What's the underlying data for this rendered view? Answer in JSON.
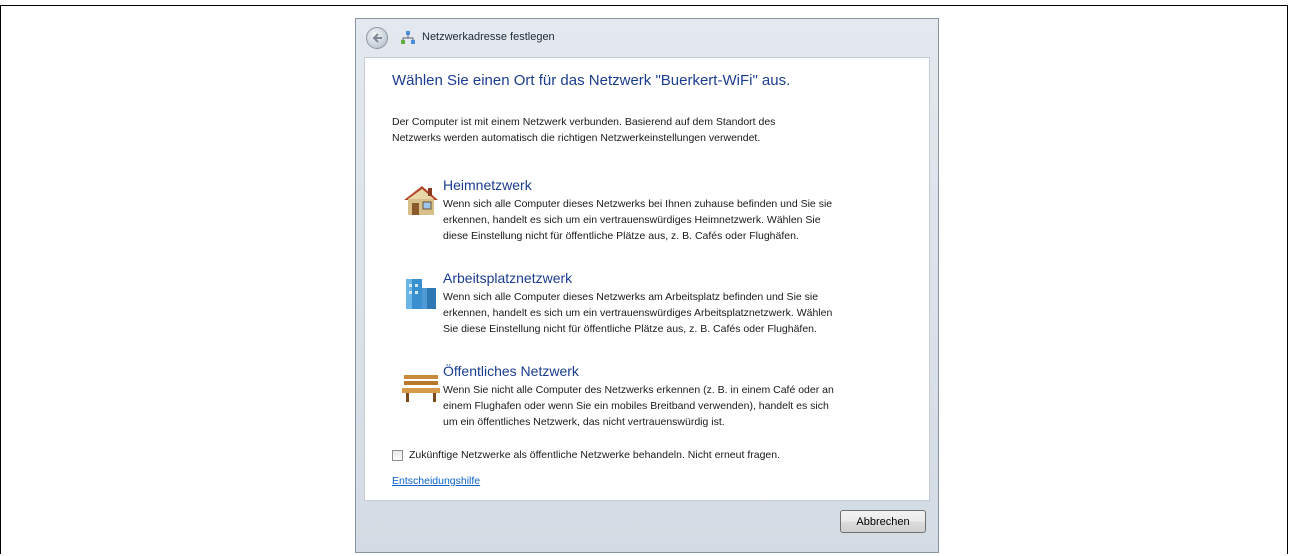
{
  "window": {
    "title": "Netzwerkadresse festlegen"
  },
  "main": {
    "heading": "Wählen Sie einen Ort für das Netzwerk \"Buerkert-WiFi\" aus.",
    "intro_line1": "Der Computer ist mit einem Netzwerk verbunden. Basierend auf dem Standort des",
    "intro_line2": "Netzwerks werden automatisch die richtigen Netzwerkeinstellungen verwendet.",
    "options": [
      {
        "icon": "house-icon",
        "title": "Heimnetzwerk",
        "lines": [
          "Wenn sich alle Computer dieses Netzwerks bei Ihnen zuhause befinden und Sie sie",
          "erkennen, handelt es sich um ein vertrauenswürdiges Heimnetzwerk. Wählen Sie",
          "diese Einstellung nicht für öffentliche Plätze aus, z. B. Cafés oder Flughäfen."
        ]
      },
      {
        "icon": "office-building-icon",
        "title": "Arbeitsplatznetzwerk",
        "lines": [
          "Wenn sich alle Computer dieses Netzwerks am Arbeitsplatz befinden und Sie sie",
          "erkennen, handelt es sich um ein vertrauenswürdiges Arbeitsplatznetzwerk. Wählen",
          "Sie diese Einstellung nicht für öffentliche Plätze aus, z. B. Cafés oder Flughäfen."
        ]
      },
      {
        "icon": "park-bench-icon",
        "title": "Öffentliches Netzwerk",
        "lines": [
          "Wenn Sie nicht alle Computer des Netzwerks erkennen (z. B. in einem Café oder an",
          "einem Flughafen oder wenn Sie ein mobiles Breitband verwenden), handelt es sich",
          "um ein öffentliches Netzwerk, das nicht vertrauenswürdig ist."
        ]
      }
    ],
    "checkbox_label": "Zukünftige Netzwerke als öffentliche Netzwerke behandeln. Nicht erneut fragen.",
    "checkbox_checked": false,
    "help_link": "Entscheidungshilfe"
  },
  "footer": {
    "cancel_label": "Abbrechen"
  },
  "colors": {
    "heading": "#1b3d8f",
    "link": "#0a62c8"
  }
}
